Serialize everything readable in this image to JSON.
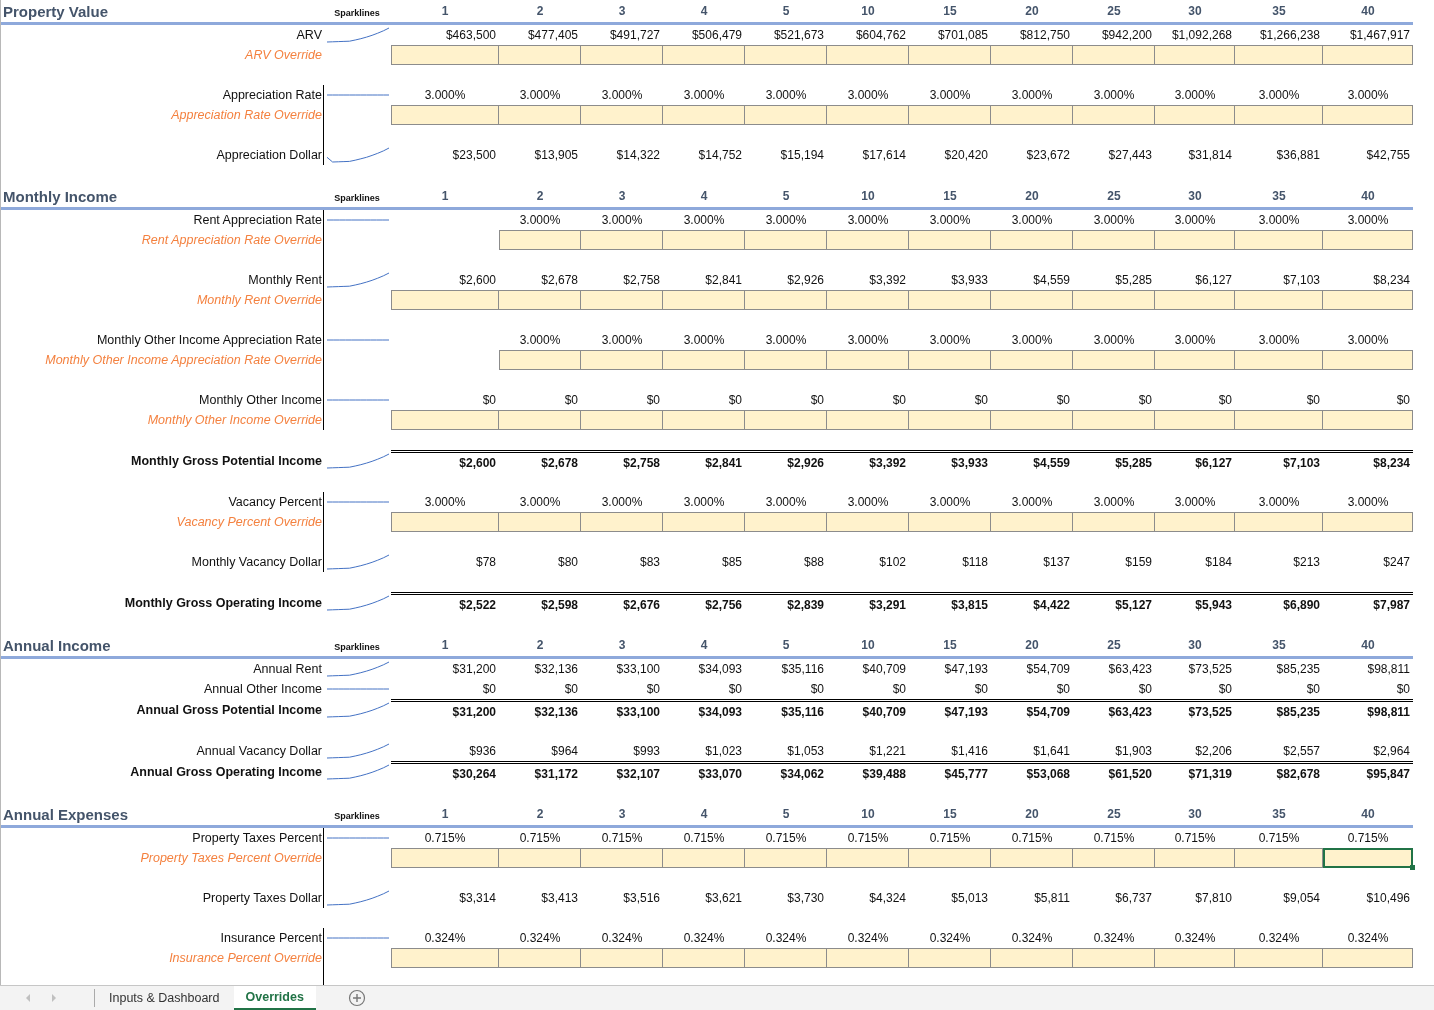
{
  "sections": [
    {
      "title": "Property Value",
      "sparklines_label": "Sparklines",
      "periods": [
        "1",
        "2",
        "3",
        "4",
        "5",
        "10",
        "15",
        "20",
        "25",
        "30",
        "35",
        "40"
      ],
      "rows": [
        {
          "kind": "amount",
          "label": "ARV",
          "values": [
            "$463,500",
            "$477,405",
            "$491,727",
            "$506,479",
            "$521,673",
            "$604,762",
            "$701,085",
            "$812,750",
            "$942,200",
            "$1,092,268",
            "$1,266,238",
            "$1,467,917"
          ]
        },
        {
          "kind": "override",
          "label": "ARV Override",
          "cells": [
            {
              "selected": false
            },
            {
              "selected": false
            },
            {
              "selected": false
            },
            {
              "selected": false
            },
            {
              "selected": false
            },
            {
              "selected": false
            },
            {
              "selected": false
            },
            {
              "selected": false
            },
            {
              "selected": false
            },
            {
              "selected": false
            },
            {
              "selected": false
            },
            {
              "selected": false
            }
          ]
        },
        {
          "kind": "blank"
        },
        {
          "kind": "rate",
          "label": "Appreciation Rate",
          "bracket": true,
          "values": [
            "3.000%",
            "3.000%",
            "3.000%",
            "3.000%",
            "3.000%",
            "3.000%",
            "3.000%",
            "3.000%",
            "3.000%",
            "3.000%",
            "3.000%",
            "3.000%"
          ]
        },
        {
          "kind": "override",
          "label": "Appreciation Rate Override",
          "bracket": true,
          "cells": [
            {
              "selected": false
            },
            {
              "selected": false
            },
            {
              "selected": false
            },
            {
              "selected": false
            },
            {
              "selected": false
            },
            {
              "selected": false
            },
            {
              "selected": false
            },
            {
              "selected": false
            },
            {
              "selected": false
            },
            {
              "selected": false
            },
            {
              "selected": false
            },
            {
              "selected": false
            }
          ]
        },
        {
          "kind": "blank",
          "bracket": true
        },
        {
          "kind": "amount",
          "label": "Appreciation Dollar",
          "bracket": true,
          "values": [
            "$23,500",
            "$13,905",
            "$14,322",
            "$14,752",
            "$15,194",
            "$17,614",
            "$20,420",
            "$23,672",
            "$27,443",
            "$31,814",
            "$36,881",
            "$42,755"
          ]
        },
        {
          "kind": "blank"
        }
      ]
    },
    {
      "title": "Monthly Income",
      "sparklines_label": "Sparklines",
      "periods": [
        "1",
        "2",
        "3",
        "4",
        "5",
        "10",
        "15",
        "20",
        "25",
        "30",
        "35",
        "40"
      ],
      "rows": [
        {
          "kind": "rate",
          "label": "Rent Appreciation Rate",
          "bracket": true,
          "values": [
            "3.000%",
            "3.000%",
            "3.000%",
            "3.000%",
            "3.000%",
            "3.000%",
            "3.000%",
            "3.000%",
            "3.000%",
            "3.000%",
            "3.000%"
          ]
        },
        {
          "kind": "override",
          "label": "Rent Appreciation Rate Override",
          "bracket": true,
          "cells": [
            {
              "selected": false
            },
            {
              "selected": false
            },
            {
              "selected": false
            },
            {
              "selected": false
            },
            {
              "selected": false
            },
            {
              "selected": false
            },
            {
              "selected": false
            },
            {
              "selected": false
            },
            {
              "selected": false
            },
            {
              "selected": false
            },
            {
              "selected": false
            }
          ]
        },
        {
          "kind": "blank",
          "bracket": true
        },
        {
          "kind": "amount",
          "label": "Monthly Rent",
          "bracket": true,
          "values": [
            "$2,600",
            "$2,678",
            "$2,758",
            "$2,841",
            "$2,926",
            "$3,392",
            "$3,933",
            "$4,559",
            "$5,285",
            "$6,127",
            "$7,103",
            "$8,234"
          ]
        },
        {
          "kind": "override",
          "label": "Monthly Rent Override",
          "bracket": true,
          "cells": [
            {
              "selected": false
            },
            {
              "selected": false
            },
            {
              "selected": false
            },
            {
              "selected": false
            },
            {
              "selected": false
            },
            {
              "selected": false
            },
            {
              "selected": false
            },
            {
              "selected": false
            },
            {
              "selected": false
            },
            {
              "selected": false
            },
            {
              "selected": false
            },
            {
              "selected": false
            }
          ]
        },
        {
          "kind": "blank",
          "bracket": true
        },
        {
          "kind": "rate",
          "label": "Monthly Other Income Appreciation Rate",
          "bracket": true,
          "values": [
            "3.000%",
            "3.000%",
            "3.000%",
            "3.000%",
            "3.000%",
            "3.000%",
            "3.000%",
            "3.000%",
            "3.000%",
            "3.000%",
            "3.000%"
          ]
        },
        {
          "kind": "override",
          "label": "Monthly Other Income Appreciation Rate Override",
          "bracket": true,
          "cells": [
            {
              "selected": false
            },
            {
              "selected": false
            },
            {
              "selected": false
            },
            {
              "selected": false
            },
            {
              "selected": false
            },
            {
              "selected": false
            },
            {
              "selected": false
            },
            {
              "selected": false
            },
            {
              "selected": false
            },
            {
              "selected": false
            },
            {
              "selected": false
            }
          ]
        },
        {
          "kind": "blank",
          "bracket": true
        },
        {
          "kind": "amount",
          "label": "Monthly Other Income",
          "bracket": true,
          "values": [
            "$0",
            "$0",
            "$0",
            "$0",
            "$0",
            "$0",
            "$0",
            "$0",
            "$0",
            "$0",
            "$0",
            "$0"
          ]
        },
        {
          "kind": "override",
          "label": "Monthly Other Income Override",
          "bracket": true,
          "cells": [
            {
              "selected": false
            },
            {
              "selected": false
            },
            {
              "selected": false
            },
            {
              "selected": false
            },
            {
              "selected": false
            },
            {
              "selected": false
            },
            {
              "selected": false
            },
            {
              "selected": false
            },
            {
              "selected": false
            },
            {
              "selected": false
            },
            {
              "selected": false
            },
            {
              "selected": false
            }
          ]
        },
        {
          "kind": "blank"
        },
        {
          "kind": "total",
          "label": "Monthly Gross Potential Income",
          "values": [
            "$2,600",
            "$2,678",
            "$2,758",
            "$2,841",
            "$2,926",
            "$3,392",
            "$3,933",
            "$4,559",
            "$5,285",
            "$6,127",
            "$7,103",
            "$8,234"
          ]
        },
        {
          "kind": "blank"
        },
        {
          "kind": "rate",
          "label": "Vacancy Percent",
          "bracket": true,
          "values": [
            "3.000%",
            "3.000%",
            "3.000%",
            "3.000%",
            "3.000%",
            "3.000%",
            "3.000%",
            "3.000%",
            "3.000%",
            "3.000%",
            "3.000%",
            "3.000%"
          ]
        },
        {
          "kind": "override",
          "label": "Vacancy Percent Override",
          "bracket": true,
          "cells": [
            {
              "selected": false
            },
            {
              "selected": false
            },
            {
              "selected": false
            },
            {
              "selected": false
            },
            {
              "selected": false
            },
            {
              "selected": false
            },
            {
              "selected": false
            },
            {
              "selected": false
            },
            {
              "selected": false
            },
            {
              "selected": false
            },
            {
              "selected": false
            },
            {
              "selected": false
            }
          ]
        },
        {
          "kind": "blank",
          "bracket": true
        },
        {
          "kind": "amount",
          "label": "Monthly Vacancy Dollar",
          "bracket": true,
          "values": [
            "$78",
            "$80",
            "$83",
            "$85",
            "$88",
            "$102",
            "$118",
            "$137",
            "$159",
            "$184",
            "$213",
            "$247"
          ]
        },
        {
          "kind": "blank"
        },
        {
          "kind": "total",
          "label": "Monthly Gross Operating Income",
          "values": [
            "$2,522",
            "$2,598",
            "$2,676",
            "$2,756",
            "$2,839",
            "$3,291",
            "$3,815",
            "$4,422",
            "$5,127",
            "$5,943",
            "$6,890",
            "$7,987"
          ]
        },
        {
          "kind": "blank"
        }
      ]
    },
    {
      "title": "Annual Income",
      "sparklines_label": "Sparklines",
      "periods": [
        "1",
        "2",
        "3",
        "4",
        "5",
        "10",
        "15",
        "20",
        "25",
        "30",
        "35",
        "40"
      ],
      "rows": [
        {
          "kind": "amount",
          "label": "Annual Rent",
          "values": [
            "$31,200",
            "$32,136",
            "$33,100",
            "$34,093",
            "$35,116",
            "$40,709",
            "$47,193",
            "$54,709",
            "$63,423",
            "$73,525",
            "$85,235",
            "$98,811"
          ]
        },
        {
          "kind": "amount",
          "label": "Annual Other Income",
          "values": [
            "$0",
            "$0",
            "$0",
            "$0",
            "$0",
            "$0",
            "$0",
            "$0",
            "$0",
            "$0",
            "$0",
            "$0"
          ]
        },
        {
          "kind": "total",
          "label": "Annual Gross Potential Income",
          "values": [
            "$31,200",
            "$32,136",
            "$33,100",
            "$34,093",
            "$35,116",
            "$40,709",
            "$47,193",
            "$54,709",
            "$63,423",
            "$73,525",
            "$85,235",
            "$98,811"
          ]
        },
        {
          "kind": "blank"
        },
        {
          "kind": "amount",
          "label": "Annual Vacancy Dollar",
          "values": [
            "$936",
            "$964",
            "$993",
            "$1,023",
            "$1,053",
            "$1,221",
            "$1,416",
            "$1,641",
            "$1,903",
            "$2,206",
            "$2,557",
            "$2,964"
          ]
        },
        {
          "kind": "total",
          "label": "Annual Gross Operating Income",
          "values": [
            "$30,264",
            "$31,172",
            "$32,107",
            "$33,070",
            "$34,062",
            "$39,488",
            "$45,777",
            "$53,068",
            "$61,520",
            "$71,319",
            "$82,678",
            "$95,847"
          ]
        },
        {
          "kind": "blank"
        }
      ]
    },
    {
      "title": "Annual Expenses",
      "sparklines_label": "Sparklines",
      "periods": [
        "1",
        "2",
        "3",
        "4",
        "5",
        "10",
        "15",
        "20",
        "25",
        "30",
        "35",
        "40"
      ],
      "rows": [
        {
          "kind": "rate",
          "label": "Property Taxes Percent",
          "bracket": true,
          "values": [
            "0.715%",
            "0.715%",
            "0.715%",
            "0.715%",
            "0.715%",
            "0.715%",
            "0.715%",
            "0.715%",
            "0.715%",
            "0.715%",
            "0.715%",
            "0.715%"
          ]
        },
        {
          "kind": "override",
          "label": "Property Taxes Percent Override",
          "bracket": true,
          "cells": [
            {
              "selected": false
            },
            {
              "selected": false
            },
            {
              "selected": false
            },
            {
              "selected": false
            },
            {
              "selected": false
            },
            {
              "selected": false
            },
            {
              "selected": false
            },
            {
              "selected": false
            },
            {
              "selected": false
            },
            {
              "selected": false
            },
            {
              "selected": false
            },
            {
              "selected": true
            }
          ]
        },
        {
          "kind": "blank",
          "bracket": true
        },
        {
          "kind": "amount",
          "label": "Property Taxes Dollar",
          "bracket": true,
          "values": [
            "$3,314",
            "$3,413",
            "$3,516",
            "$3,621",
            "$3,730",
            "$4,324",
            "$5,013",
            "$5,811",
            "$6,737",
            "$7,810",
            "$9,054",
            "$10,496"
          ]
        },
        {
          "kind": "blank"
        },
        {
          "kind": "rate",
          "label": "Insurance Percent",
          "bracket": true,
          "values": [
            "0.324%",
            "0.324%",
            "0.324%",
            "0.324%",
            "0.324%",
            "0.324%",
            "0.324%",
            "0.324%",
            "0.324%",
            "0.324%",
            "0.324%",
            "0.324%"
          ]
        },
        {
          "kind": "override",
          "label": "Insurance Percent Override",
          "bracket": true,
          "cells": [
            {
              "selected": false
            },
            {
              "selected": false
            },
            {
              "selected": false
            },
            {
              "selected": false
            },
            {
              "selected": false
            },
            {
              "selected": false
            },
            {
              "selected": false
            },
            {
              "selected": false
            },
            {
              "selected": false
            },
            {
              "selected": false
            },
            {
              "selected": false
            },
            {
              "selected": false
            }
          ]
        },
        {
          "kind": "blank",
          "bracket": true
        }
      ]
    }
  ],
  "sheet_tabs": [
    {
      "label": "Inputs & Dashboard",
      "selected": false
    },
    {
      "label": "Overrides",
      "selected": true
    }
  ]
}
